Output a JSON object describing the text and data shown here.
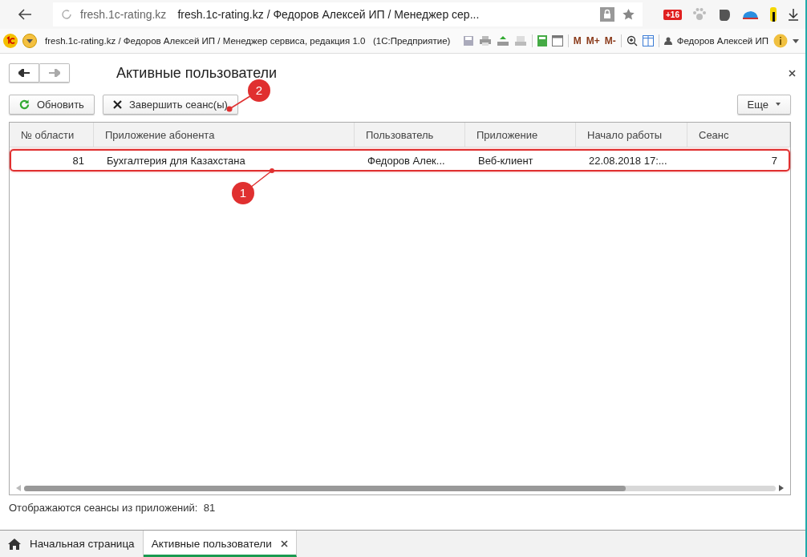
{
  "browser": {
    "domain": "fresh.1c-rating.kz",
    "page_title": "fresh.1c-rating.kz / Федоров Алексей ИП / Менеджер сер...",
    "badge": "+16"
  },
  "app_bar": {
    "caption": "fresh.1c-rating.kz / Федоров Алексей ИП / Менеджер сервиса, редакция 1.0   (1С:Предприятие)",
    "memory_buttons": [
      "M",
      "M+",
      "M-"
    ],
    "user": "Федоров Алексей ИП"
  },
  "form": {
    "title": "Активные пользователи",
    "buttons": [
      {
        "kind": "refresh",
        "label": "Обновить"
      },
      {
        "kind": "end",
        "label": "Завершить сеанс(ы)"
      }
    ],
    "more": "Еще",
    "table": {
      "columns": [
        {
          "label": "№ области",
          "kind": "number"
        },
        {
          "label": "Приложение абонента",
          "kind": "text"
        },
        {
          "label": "Пользователь",
          "kind": "text"
        },
        {
          "label": "Приложение",
          "kind": "text"
        },
        {
          "label": "Начало работы",
          "kind": "text"
        },
        {
          "label": "Сеанс",
          "kind": "number"
        }
      ],
      "rows": [
        {
          "selected": true,
          "cells": [
            "81",
            "Бухгалтерия для Казахстана",
            "Федоров Алек...",
            "Веб-клиент",
            "22.08.2018 17:...",
            "7"
          ]
        }
      ]
    },
    "status": "Отображаются сеансы из приложений:  81"
  },
  "annotations": [
    {
      "label": "1"
    },
    {
      "label": "2"
    }
  ],
  "tabs": [
    {
      "kind": "home",
      "label": "Начальная страница",
      "selected": false
    },
    {
      "kind": "page",
      "label": "Активные пользователи",
      "selected": true
    }
  ]
}
